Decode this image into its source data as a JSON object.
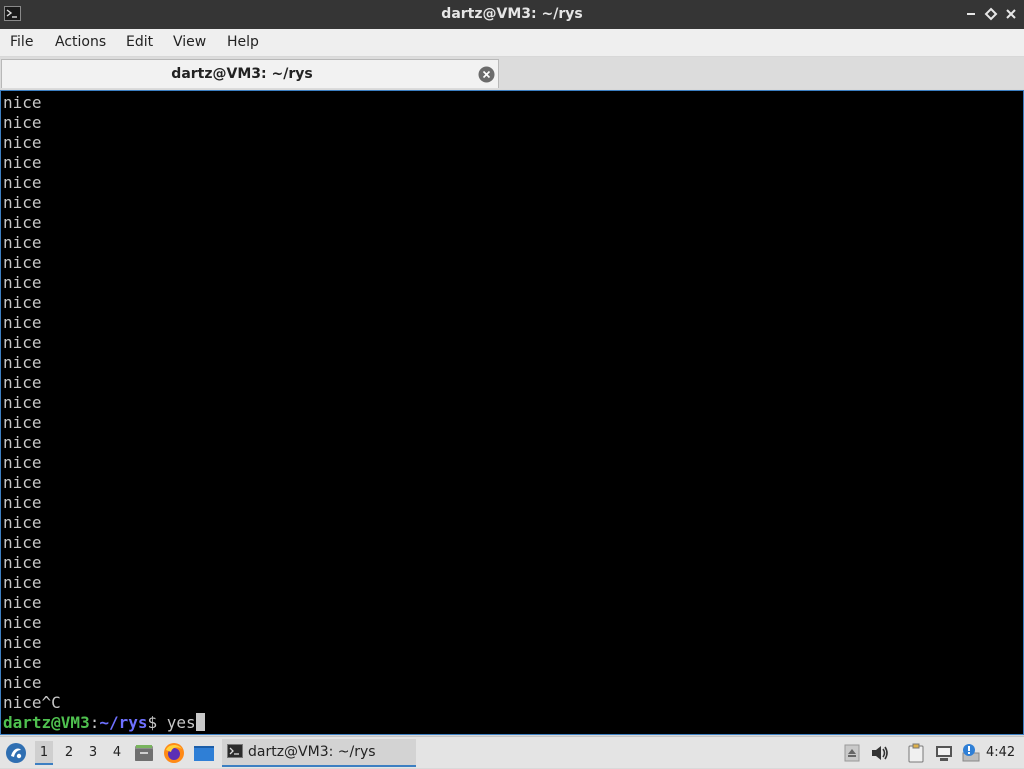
{
  "window": {
    "title": "dartz@VM3: ~/rys"
  },
  "menubar": {
    "items": [
      "File",
      "Actions",
      "Edit",
      "View",
      "Help"
    ]
  },
  "tabs": [
    {
      "label": "dartz@VM3: ~/rys",
      "active": true
    }
  ],
  "terminal": {
    "output_lines": [
      "nice",
      "nice",
      "nice",
      "nice",
      "nice",
      "nice",
      "nice",
      "nice",
      "nice",
      "nice",
      "nice",
      "nice",
      "nice",
      "nice",
      "nice",
      "nice",
      "nice",
      "nice",
      "nice",
      "nice",
      "nice",
      "nice",
      "nice",
      "nice",
      "nice",
      "nice",
      "nice",
      "nice",
      "nice",
      "nice",
      "nice^C"
    ],
    "prompt": {
      "user_host": "dartz@VM3",
      "separator": ":",
      "path": "~/rys",
      "symbol": "$ ",
      "command": "yes"
    },
    "colors": {
      "background": "#000000",
      "text": "#c8c8c8",
      "user_host": "#4fc14f",
      "path": "#6e70ff"
    }
  },
  "taskbar": {
    "start_icon": "lxqt-start-icon",
    "workspaces": [
      "1",
      "2",
      "3",
      "4"
    ],
    "active_workspace": "1",
    "launchers": [
      "file-manager-icon",
      "firefox-icon",
      "show-desktop-icon"
    ],
    "tasks": [
      {
        "label": "dartz@VM3: ~/rys",
        "icon": "terminal-icon",
        "active": true
      }
    ],
    "tray_icons": [
      "eject-icon",
      "volume-icon",
      "clipboard-icon",
      "network-icon",
      "notification-icon"
    ],
    "clock": "4:42",
    "accent": "#3c7fc2"
  }
}
